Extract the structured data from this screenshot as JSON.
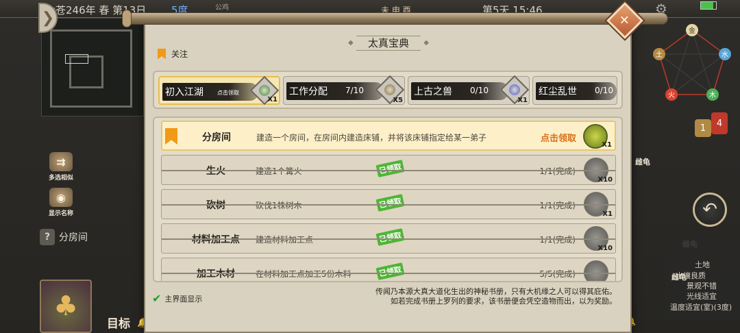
{
  "topbar": {
    "date": "太苍246年 春 第13日",
    "temperature": "5度",
    "weather": "公鸡",
    "calendar": "未 申 酉",
    "day_time": "第5天 15:46"
  },
  "side_buttons": [
    {
      "label": "多选相似"
    },
    {
      "label": "显示名称"
    }
  ],
  "help_item": {
    "icon": "?",
    "label": "分房间"
  },
  "bottom_nav": {
    "goal": "目标",
    "queue": "队列"
  },
  "five_elements": [
    "金",
    "水",
    "木",
    "火",
    "土"
  ],
  "notifications": {
    "badge_yellow": "1",
    "badge_red": "4"
  },
  "right_labels": {
    "turtle1": "雌龟",
    "turtle2": "雌龟",
    "turtle3": "雌龟",
    "frog": "雌蛙"
  },
  "info_panel": [
    "土地",
    "土壤良质",
    "景观不错",
    "光线适宜",
    "温度适宜(室)(3度)"
  ],
  "modal": {
    "title": "太真宝典",
    "follow_label": "关注",
    "tabs": [
      {
        "name": "初入江湖",
        "hint": "点击领取",
        "reward_qty": "X1",
        "reward_color": "#3f8f2c"
      },
      {
        "name": "工作分配",
        "progress": "7/10",
        "reward_qty": "X5",
        "reward_color": "#8a7030"
      },
      {
        "name": "上古之兽",
        "progress": "0/10",
        "reward_qty": "X1",
        "reward_color": "#4f5ad0"
      },
      {
        "name": "红尘乱世",
        "progress": "0/10"
      }
    ],
    "tasks": [
      {
        "name": "分房间",
        "desc": "建造一个房间，在房间内建造床铺，并将该床铺指定给某一弟子",
        "status": "点击领取",
        "qty": "X1"
      },
      {
        "name": "生火",
        "desc": "建造1个篝火",
        "stamp": "已领取",
        "status": "1/1(完成)",
        "qty": "X10"
      },
      {
        "name": "砍树",
        "desc": "砍伐1株树木",
        "stamp": "已领取",
        "status": "1/1(完成)",
        "qty": "X1"
      },
      {
        "name": "材料加工点",
        "desc": "建造材料加工点",
        "stamp": "已领取",
        "status": "1/1(完成)",
        "qty": "X10"
      },
      {
        "name": "加工木材",
        "desc": "在材料加工点加工5份木料",
        "stamp": "已领取",
        "status": "5/5(完成)",
        "qty": ""
      }
    ],
    "main_screen_label": "主界面显示",
    "intro_line1": "传闻乃本源大真大道化生出的神秘书册，只有大机缘之人可以得其庇佑。",
    "intro_line2": "如若完成书册上罗列的要求，该书册便会凭空造物而出，以为奖励。"
  }
}
